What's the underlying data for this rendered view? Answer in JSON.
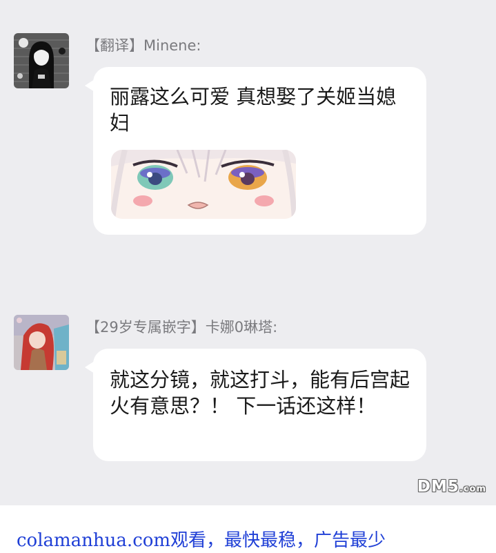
{
  "messages": [
    {
      "sender": "【翻译】Minene:",
      "text": "丽露这么可爱  真想娶了关姬当媳妇",
      "avatar_icon": "girl-avatar-icon",
      "sticker": "anime-eyes-sticker"
    },
    {
      "sender": "【29岁专属嵌字】卡娜0琳塔:",
      "text": "就这分镜，就这打斗，能有后宫起火有意思？！ 下一话还这样！",
      "avatar_icon": "redhair-girl-avatar-icon"
    }
  ],
  "watermark": {
    "brand": "DM5",
    "suffix": ".com"
  },
  "footer": {
    "text": "colamanhua.com观看，最快最稳，广告最少"
  },
  "colors": {
    "background": "#ededf0",
    "bubble": "#ffffff",
    "sender": "#7a7a7e",
    "footer_link": "#1f3fd6"
  }
}
